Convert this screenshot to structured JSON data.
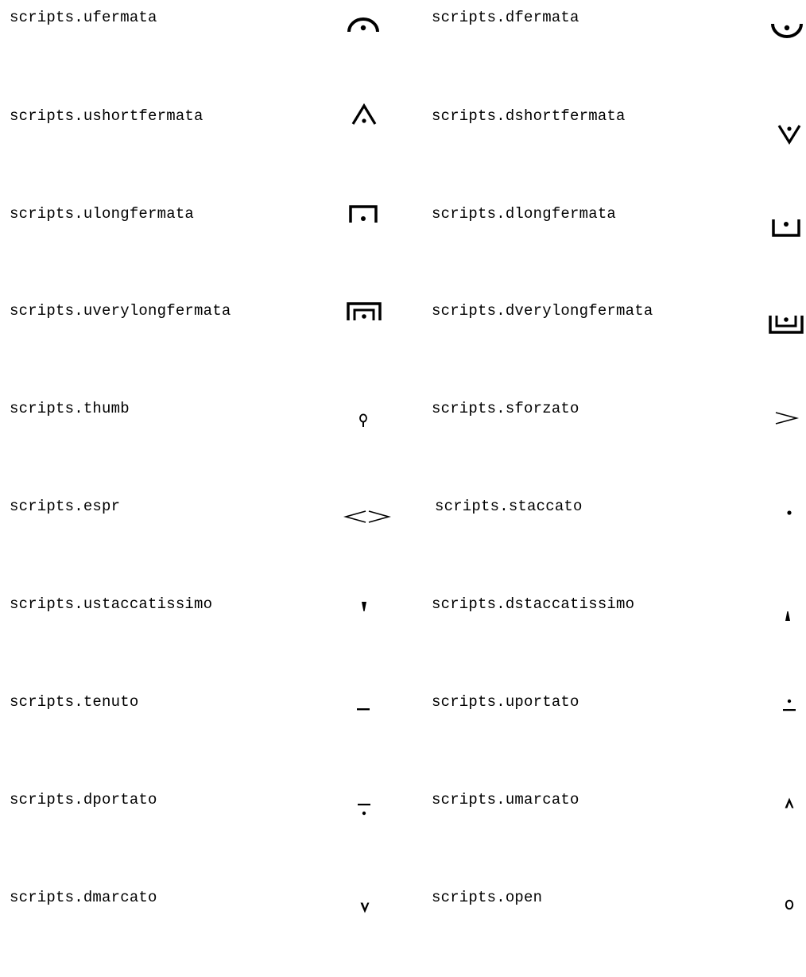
{
  "page": {
    "background": "#ffffff",
    "ink": "#000000"
  },
  "entries": [
    {
      "name": "scripts.ufermata",
      "icon": "ufermata-icon"
    },
    {
      "name": "scripts.dfermata",
      "icon": "dfermata-icon"
    },
    {
      "name": "scripts.ushortfermata",
      "icon": "ushortfermata-icon"
    },
    {
      "name": "scripts.dshortfermata",
      "icon": "dshortfermata-icon"
    },
    {
      "name": "scripts.ulongfermata",
      "icon": "ulongfermata-icon"
    },
    {
      "name": "scripts.dlongfermata",
      "icon": "dlongfermata-icon"
    },
    {
      "name": "scripts.uverylongfermata",
      "icon": "uverylongfermata-icon"
    },
    {
      "name": "scripts.dverylongfermata",
      "icon": "dverylongfermata-icon"
    },
    {
      "name": "scripts.thumb",
      "icon": "thumb-icon"
    },
    {
      "name": "scripts.sforzato",
      "icon": "sforzato-icon"
    },
    {
      "name": "scripts.espr",
      "icon": "espr-icon"
    },
    {
      "name": "scripts.staccato",
      "icon": "staccato-icon"
    },
    {
      "name": "scripts.ustaccatissimo",
      "icon": "ustaccatissimo-icon"
    },
    {
      "name": "scripts.dstaccatissimo",
      "icon": "dstaccatissimo-icon"
    },
    {
      "name": "scripts.tenuto",
      "icon": "tenuto-icon"
    },
    {
      "name": "scripts.uportato",
      "icon": "uportato-icon"
    },
    {
      "name": "scripts.dportato",
      "icon": "dportato-icon"
    },
    {
      "name": "scripts.umarcato",
      "icon": "umarcato-icon"
    },
    {
      "name": "scripts.dmarcato",
      "icon": "dmarcato-icon"
    },
    {
      "name": "scripts.open",
      "icon": "open-icon"
    }
  ]
}
